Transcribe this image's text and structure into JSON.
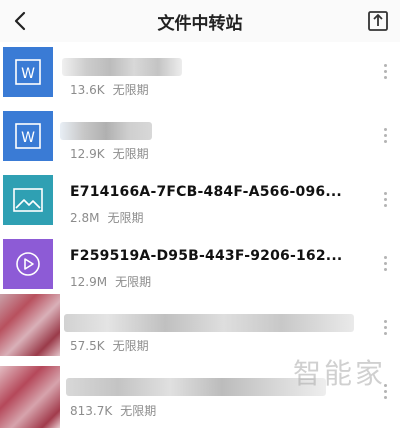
{
  "header": {
    "title": "文件中转站"
  },
  "colors": {
    "word": "#3a7bd5",
    "image": "#2fa0b3",
    "video": "#8d5bd6",
    "meta": "#8c8c8c"
  },
  "files": [
    {
      "icon": "word-doc-icon",
      "name": "",
      "size": "13.6K",
      "expiry": "无限期"
    },
    {
      "icon": "word-doc-icon",
      "name": "",
      "size": "12.9K",
      "expiry": "无限期"
    },
    {
      "icon": "image-file-icon",
      "name": "E714166A-7FCB-484F-A566-096...",
      "size": "2.8M",
      "expiry": "无限期"
    },
    {
      "icon": "video-file-icon",
      "name": "F259519A-D95B-443F-9206-162...",
      "size": "12.9M",
      "expiry": "无限期"
    },
    {
      "icon": "image-thumbnail",
      "name": "",
      "size": "57.5K",
      "expiry": "无限期"
    },
    {
      "icon": "image-thumbnail",
      "name": "",
      "size": "813.7K",
      "expiry": "无限期"
    }
  ],
  "watermark": "智能家"
}
